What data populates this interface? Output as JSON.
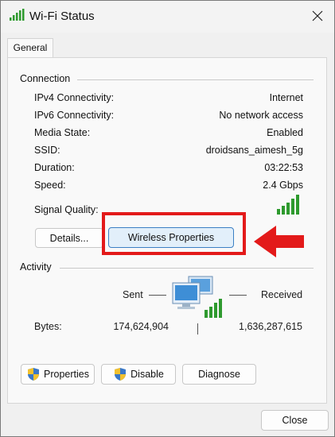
{
  "window": {
    "title": "Wi-Fi Status"
  },
  "tabs": [
    {
      "label": "General"
    }
  ],
  "connection": {
    "group_label": "Connection",
    "rows": [
      {
        "label": "IPv4 Connectivity:",
        "value": "Internet"
      },
      {
        "label": "IPv6 Connectivity:",
        "value": "No network access"
      },
      {
        "label": "Media State:",
        "value": "Enabled"
      },
      {
        "label": "SSID:",
        "value": "droidsans_aimesh_5g"
      },
      {
        "label": "Duration:",
        "value": "03:22:53"
      },
      {
        "label": "Speed:",
        "value": "2.4 Gbps"
      }
    ],
    "signal_label": "Signal Quality:",
    "signal_bars": 5,
    "details_button": "Details...",
    "wireless_properties_button": "Wireless Properties"
  },
  "activity": {
    "group_label": "Activity",
    "sent_label": "Sent",
    "received_label": "Received",
    "bytes_label": "Bytes:",
    "bytes_sent": "174,624,904",
    "bytes_received": "1,636,287,615"
  },
  "actions": {
    "properties_button": "Properties",
    "disable_button": "Disable",
    "diagnose_button": "Diagnose"
  },
  "footer": {
    "close_button": "Close"
  },
  "colors": {
    "accent_border": "#3b7fc4",
    "highlight_red": "#e31a1a",
    "signal_green": "#2e9a2e"
  },
  "icons": [
    "wifi-signal-icon",
    "close-icon",
    "network-computers-icon",
    "uac-shield-icon",
    "red-arrow-icon"
  ]
}
